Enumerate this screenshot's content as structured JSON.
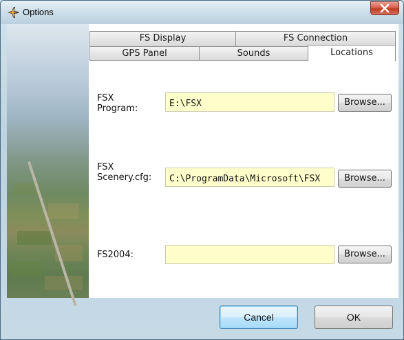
{
  "window": {
    "title": "Options",
    "close_glyph": "✕"
  },
  "tabs": {
    "row_back": [
      {
        "label": "FS Display"
      },
      {
        "label": "FS Connection"
      }
    ],
    "row_front": [
      {
        "label": "GPS Panel"
      },
      {
        "label": "Sounds"
      },
      {
        "label": "Locations",
        "active": true
      }
    ]
  },
  "locations": {
    "fsx_program": {
      "label_line1": "FSX",
      "label_line2": "Program:",
      "value": "E:\\FSX",
      "browse": "Browse..."
    },
    "fsx_scenery": {
      "label_line1": "FSX",
      "label_line2": "Scenery.cfg:",
      "value": "C:\\ProgramData\\Microsoft\\FSX",
      "browse": "Browse..."
    },
    "fs2004": {
      "label": "FS2004:",
      "value": "",
      "browse": "Browse..."
    }
  },
  "footer": {
    "cancel": "Cancel",
    "ok": "OK"
  },
  "colors": {
    "input_bg": "#ffffcc",
    "close_red": "#c03a22",
    "frame_blue": "#bdd3e0"
  },
  "icons": {
    "title_icon": "airplane-icon",
    "close_icon": "close-icon"
  }
}
